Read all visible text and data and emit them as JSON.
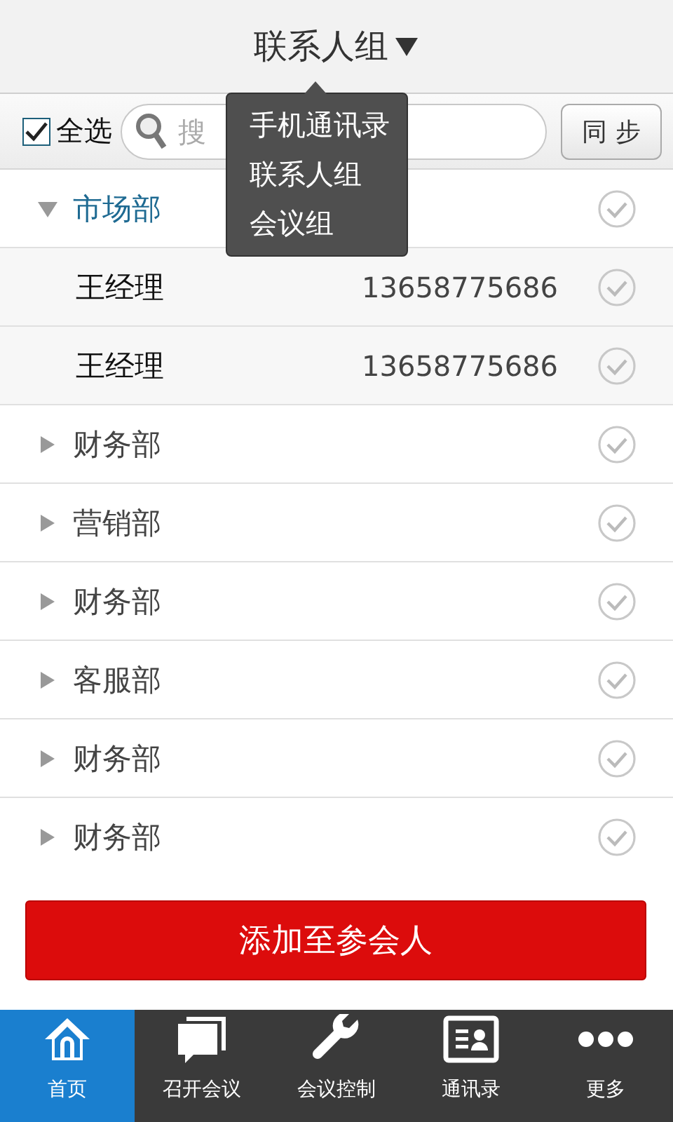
{
  "header": {
    "title": "联系人组"
  },
  "menu": {
    "items": [
      "手机通讯录",
      "联系人组",
      "会议组"
    ]
  },
  "toolbar": {
    "select_all": {
      "label": "全选",
      "checked": true
    },
    "search": {
      "placeholder": "搜"
    },
    "sync_button": "同 步"
  },
  "groups": [
    {
      "name": "市场部",
      "expanded": true,
      "checked": false,
      "children": [
        {
          "name": "王经理",
          "phone": "13658775686",
          "checked": false
        },
        {
          "name": "王经理",
          "phone": "13658775686",
          "checked": false
        }
      ]
    },
    {
      "name": "财务部",
      "expanded": false,
      "checked": false
    },
    {
      "name": "营销部",
      "expanded": false,
      "checked": false
    },
    {
      "name": "财务部",
      "expanded": false,
      "checked": false
    },
    {
      "name": "客服部",
      "expanded": false,
      "checked": false
    },
    {
      "name": "财务部",
      "expanded": false,
      "checked": false
    },
    {
      "name": "财务部",
      "expanded": false,
      "checked": false
    }
  ],
  "add_button": "添加至参会人",
  "tabs": [
    {
      "label": "首页",
      "kind": "home",
      "selected": true
    },
    {
      "label": "召开会议",
      "kind": "chat",
      "selected": false
    },
    {
      "label": "会议控制",
      "kind": "wrench",
      "selected": false
    },
    {
      "label": "通讯录",
      "kind": "card",
      "selected": false
    },
    {
      "label": "更多",
      "kind": "more",
      "selected": false
    }
  ]
}
